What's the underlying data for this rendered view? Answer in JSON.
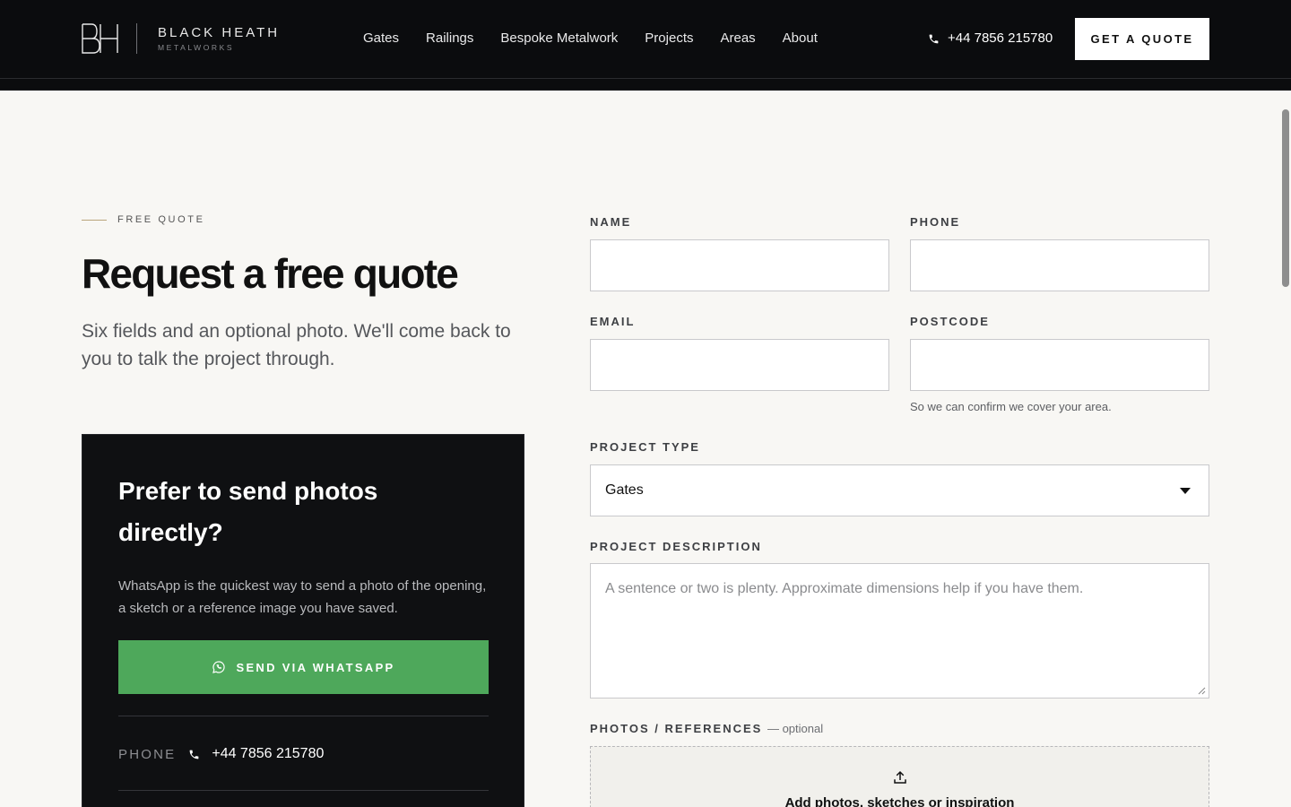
{
  "header": {
    "logo_monogram": "BH",
    "logo_name": "BLACK HEATH",
    "logo_sub": "METALWORKS",
    "nav": [
      "Gates",
      "Railings",
      "Bespoke Metalwork",
      "Projects",
      "Areas",
      "About"
    ],
    "phone": "+44 7856 215780",
    "cta": "GET A QUOTE"
  },
  "hero": {
    "eyebrow": "FREE QUOTE",
    "title": "Request a free quote",
    "lead": "Six fields and an optional photo. We'll come back to you to talk the project through."
  },
  "whatsapp_card": {
    "title": "Prefer to send photos directly?",
    "body": "WhatsApp is the quickest way to send a photo of the opening, a sketch or a reference image you have saved.",
    "button": "SEND VIA WHATSAPP",
    "phone_label": "PHONE",
    "phone": "+44 7856 215780"
  },
  "form": {
    "name_label": "NAME",
    "name_value": "",
    "phone_label": "PHONE",
    "phone_value": "",
    "email_label": "EMAIL",
    "email_value": "",
    "postcode_label": "POSTCODE",
    "postcode_value": "",
    "postcode_hint": "So we can confirm we cover your area.",
    "project_type_label": "PROJECT TYPE",
    "project_type_value": "Gates",
    "description_label": "PROJECT DESCRIPTION",
    "description_placeholder": "A sentence or two is plenty. Approximate dimensions help if you have them.",
    "photos_label": "PHOTOS / REFERENCES",
    "photos_optional": "— optional",
    "upload_text": "Add photos, sketches or inspiration"
  },
  "colors": {
    "header_bg": "#0b0c0e",
    "page_bg": "#f8f7f4",
    "accent_line": "#b9a57c",
    "whatsapp_green": "#4ea85b",
    "card_bg": "#0f1012"
  },
  "icons": [
    "phone-icon",
    "whatsapp-icon",
    "upload-icon",
    "chevron-down-icon"
  ]
}
